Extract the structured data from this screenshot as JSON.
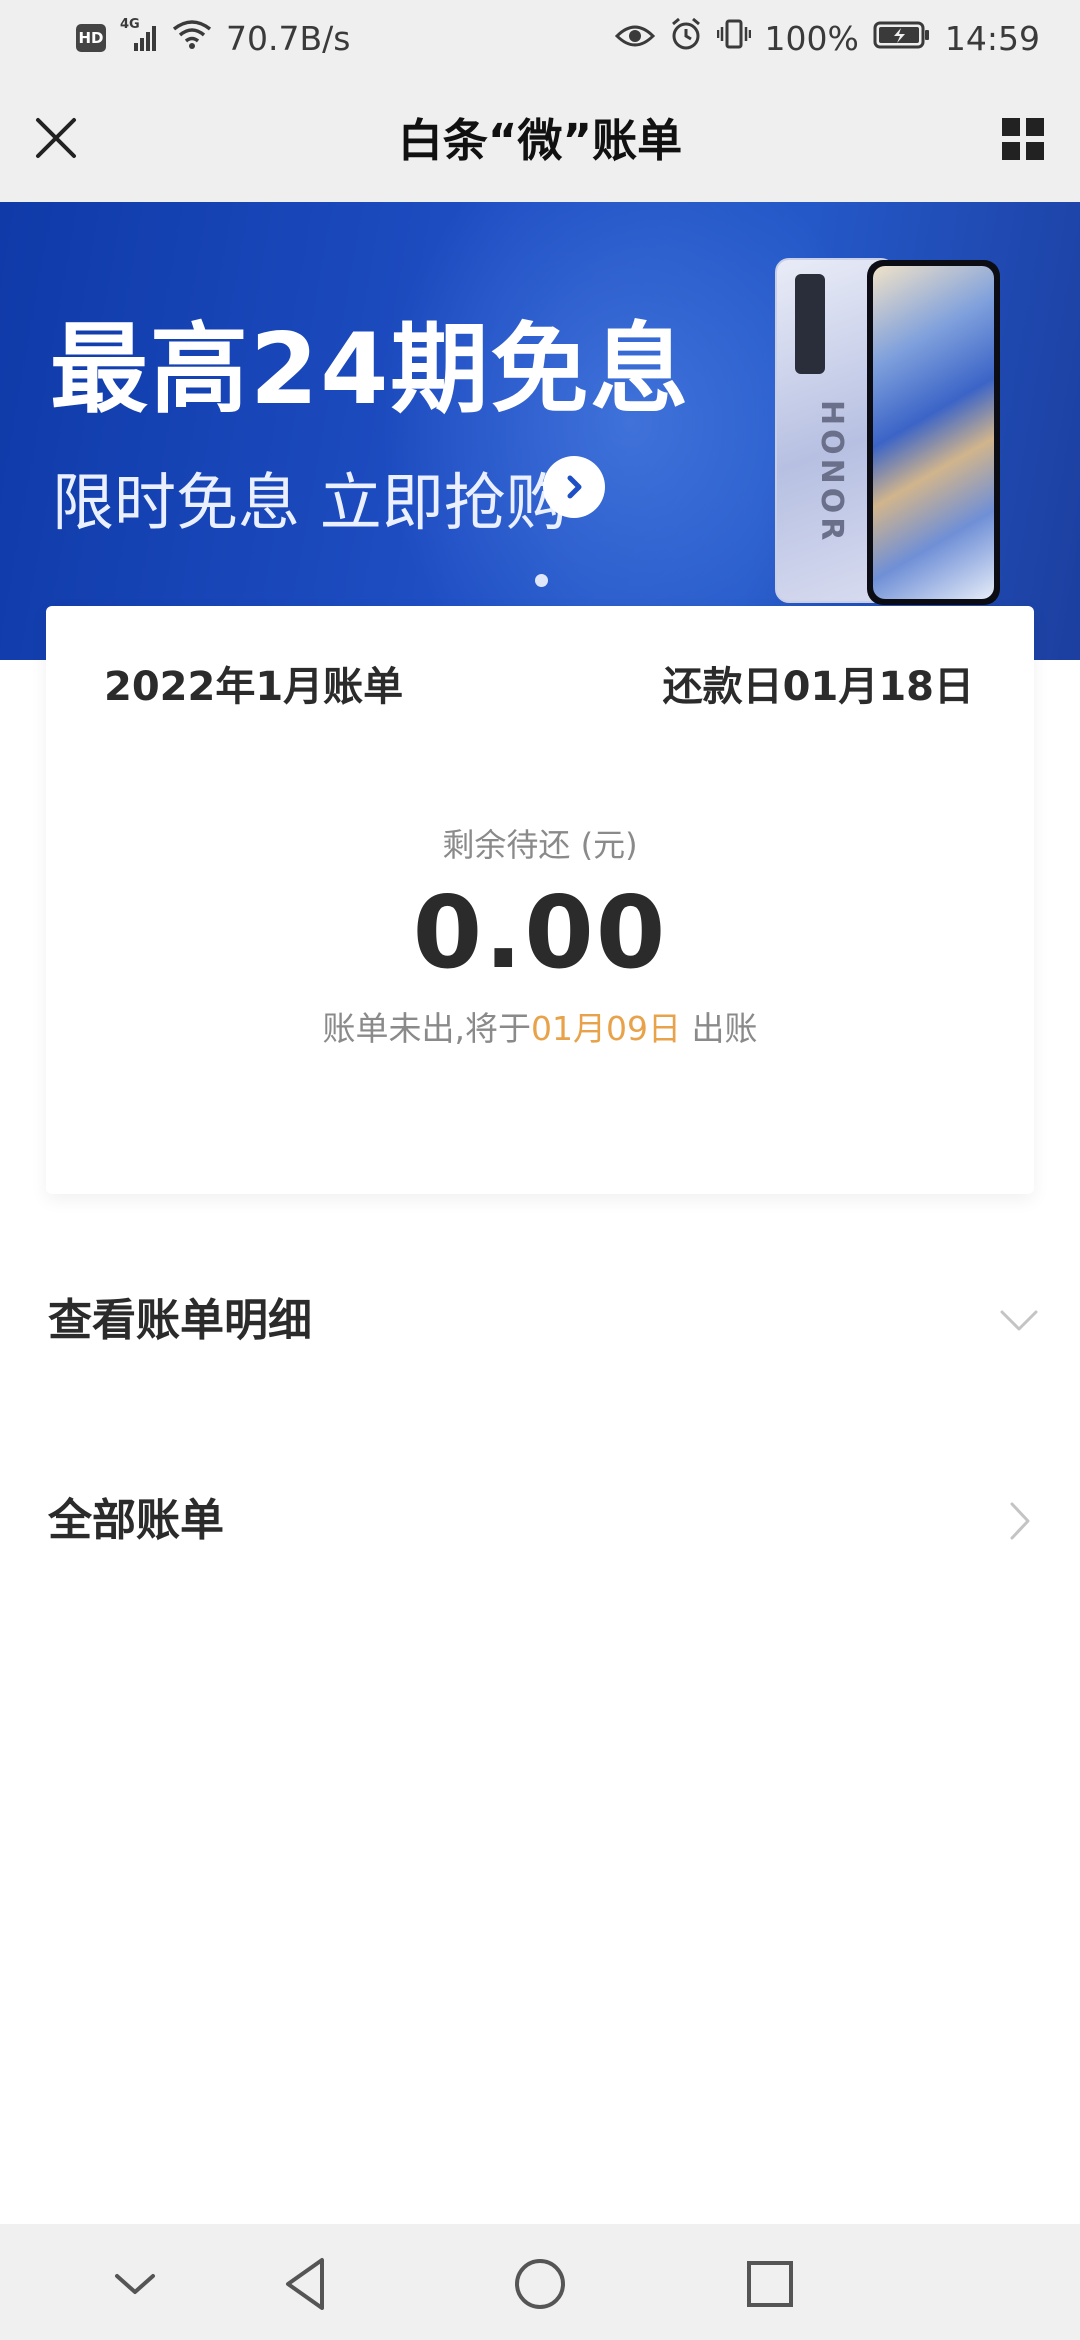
{
  "status_bar": {
    "hd_badge": "HD",
    "network_type": "4G",
    "net_speed": "70.7B/s",
    "battery_percent": "100%",
    "time": "14:59",
    "icons": [
      "hd-icon",
      "cellular-signal-icon",
      "wifi-icon",
      "eye-icon",
      "alarm-icon",
      "vibrate-icon",
      "battery-charging-icon"
    ]
  },
  "title_bar": {
    "title": "白条“微”账单",
    "close_icon": "close-icon",
    "menu_icon": "grid-menu-icon"
  },
  "banner": {
    "headline": "最高24期免息",
    "subline": "限时免息 立即抢购",
    "phone_brand": "HONOR",
    "go_icon": "chevron-right-icon",
    "colors": {
      "background": "#1f4fc4",
      "text": "#ffffff"
    },
    "page_count": 1,
    "active_page": 1
  },
  "bill": {
    "month_label": "2022年1月账单",
    "due_date_label": "还款日01月18日",
    "remaining_label": "剩余待还 (元)",
    "amount": "0.00",
    "note_prefix": "账单未出,将于",
    "note_date": "01月09日",
    "note_suffix": " 出账",
    "colors": {
      "highlight": "#e8a24a"
    }
  },
  "list": [
    {
      "label": "查看账单明细",
      "icon": "chevron-down-icon"
    },
    {
      "label": "全部账单",
      "icon": "chevron-right-icon"
    }
  ],
  "nav_bar": {
    "icons": [
      "collapse-icon",
      "back-icon",
      "home-icon",
      "recents-icon"
    ]
  }
}
